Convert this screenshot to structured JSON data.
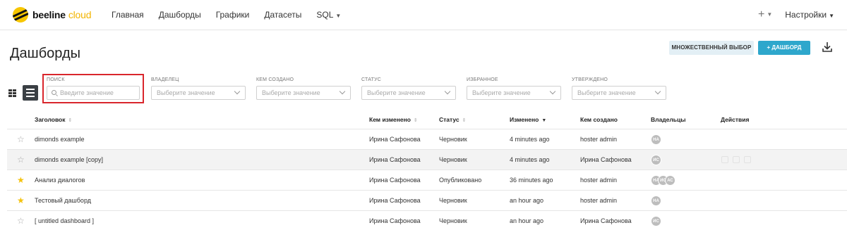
{
  "app": {
    "brand_part1": "beeline",
    "brand_part2": "cloud"
  },
  "nav": {
    "items": [
      {
        "label": "Главная"
      },
      {
        "label": "Дашборды"
      },
      {
        "label": "Графики"
      },
      {
        "label": "Датасеты"
      },
      {
        "label": "SQL"
      }
    ],
    "plus_label": "+",
    "settings_label": "Настройки"
  },
  "page": {
    "title": "Дашборды",
    "multi_select_label": "МНОЖЕСТВЕННЫЙ ВЫБОР",
    "add_dashboard_label": "+ ДАШБОРД"
  },
  "filters": {
    "search": {
      "label": "ПОИСК",
      "placeholder": "Введите значение",
      "value": ""
    },
    "owner": {
      "label": "ВЛАДЕЛЕЦ",
      "placeholder": "Выберите значение"
    },
    "created_by": {
      "label": "КЕМ СОЗДАНО",
      "placeholder": "Выберите значение"
    },
    "status": {
      "label": "СТАТУС",
      "placeholder": "Выберите значение"
    },
    "favorite": {
      "label": "ИЗБРАННОЕ",
      "placeholder": "Выберите значение"
    },
    "certified": {
      "label": "УТВЕРЖДЕНО",
      "placeholder": "Выберите значение"
    }
  },
  "table": {
    "columns": {
      "title": "Заголовок",
      "modified_by": "Кем изменено",
      "status": "Статус",
      "modified": "Изменено",
      "created_by": "Кем создано",
      "owners": "Владельцы",
      "actions": "Действия"
    },
    "rows": [
      {
        "favorite": false,
        "title": "dimonds example",
        "modified_by": "Ирина Сафонова",
        "status": "Черновик",
        "modified": "4 minutes ago",
        "created_by": "hoster admin",
        "owners": [
          "HA"
        ],
        "highlight": false
      },
      {
        "favorite": false,
        "title": "dimonds example [copy]",
        "modified_by": "Ирина Сафонова",
        "status": "Черновик",
        "modified": "4 minutes ago",
        "created_by": "Ирина Сафонова",
        "owners": [
          "ИС"
        ],
        "highlight": true
      },
      {
        "favorite": true,
        "title": "Анализ диалогов",
        "modified_by": "Ирина Сафонова",
        "status": "Опубликовано",
        "modified": "36 minutes ago",
        "created_by": "hoster admin",
        "owners": [
          "HA",
          "ИС",
          "АС"
        ],
        "highlight": false
      },
      {
        "favorite": true,
        "title": "Тестовый дашборд",
        "modified_by": "Ирина Сафонова",
        "status": "Черновик",
        "modified": "an hour ago",
        "created_by": "hoster admin",
        "owners": [
          "HA"
        ],
        "highlight": false
      },
      {
        "favorite": false,
        "title": "[ untitled dashboard ]",
        "modified_by": "Ирина Сафонова",
        "status": "Черновик",
        "modified": "an hour ago",
        "created_by": "Ирина Сафонова",
        "owners": [
          "ИС"
        ],
        "highlight": false
      }
    ]
  },
  "colors": {
    "brand_yellow": "#f7c600",
    "primary_button": "#2ea7cc",
    "secondary_button": "#e3eff5",
    "highlight_border": "#d9262c",
    "star_on": "#f4c20d"
  }
}
